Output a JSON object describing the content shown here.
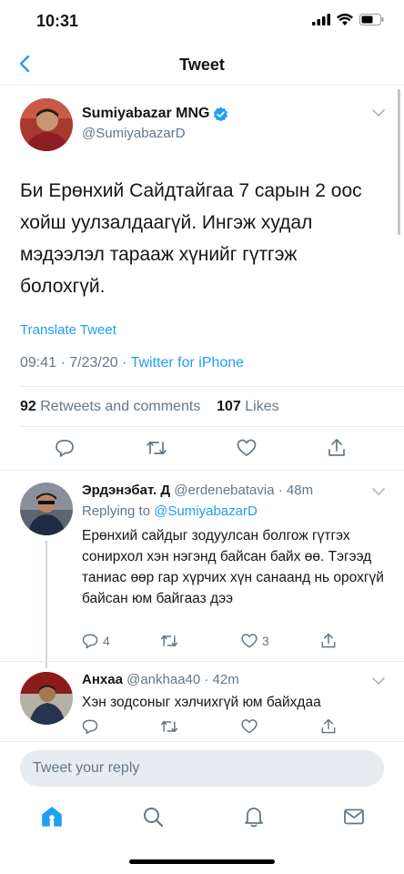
{
  "status": {
    "time": "10:31"
  },
  "nav": {
    "title": "Tweet"
  },
  "tweet": {
    "name": "Sumiyabazar MNG",
    "handle": "@SumiyabazarD",
    "text": "Би Ерөнхий Сайдтайгаа 7 сарын 2 оос хойш уулзалдаагүй. Ингэж худал мэдээлэл тарааж хүнийг гүтгэж болохгүй.",
    "translate": "Translate Tweet",
    "time": "09:41 · 7/23/20 · ",
    "source": "Twitter for iPhone",
    "retweets_count": "92",
    "retweets_label": "Retweets and comments",
    "likes_count": "107",
    "likes_label": "Likes"
  },
  "replies": [
    {
      "name": "Эрдэнэбат. Д",
      "handle": "@erdenebatavia · 48m",
      "replying_prefix": "Replying to ",
      "replying_to": "@SumiyabazarD",
      "text": "Ерөнхий сайдыг зодуулсан болгож гүтгэх сонирхол хэн нэгэнд байсан байх өө. Тэгээд таниас өөр гар хүрчих хүн санаанд нь орохгүй байсан юм байгааз дээ",
      "reply_count": "4",
      "like_count": "3"
    },
    {
      "name": "Анхаа",
      "handle": "@ankhaa40 · 42m",
      "text": "Хэн зодсоныг хэлчихгүй юм байхдаа"
    }
  ],
  "compose": {
    "placeholder": "Tweet your reply"
  },
  "colors": {
    "accent": "#1da1f2",
    "secondary": "#657786",
    "border": "#e6ecf0"
  }
}
